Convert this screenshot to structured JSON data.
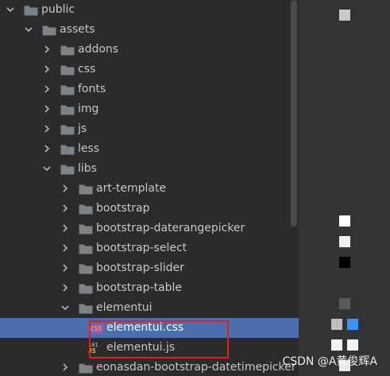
{
  "tree": {
    "items": [
      {
        "label": "public",
        "type": "folder",
        "expanded": true,
        "depth": 0
      },
      {
        "label": "assets",
        "type": "folder",
        "expanded": true,
        "depth": 1
      },
      {
        "label": "addons",
        "type": "folder",
        "expanded": false,
        "depth": 2
      },
      {
        "label": "css",
        "type": "folder",
        "expanded": false,
        "depth": 2
      },
      {
        "label": "fonts",
        "type": "folder",
        "expanded": false,
        "depth": 2
      },
      {
        "label": "img",
        "type": "folder",
        "expanded": false,
        "depth": 2
      },
      {
        "label": "js",
        "type": "folder",
        "expanded": false,
        "depth": 2
      },
      {
        "label": "less",
        "type": "folder",
        "expanded": false,
        "depth": 2
      },
      {
        "label": "libs",
        "type": "folder",
        "expanded": true,
        "depth": 2
      },
      {
        "label": "art-template",
        "type": "folder",
        "expanded": false,
        "depth": 3
      },
      {
        "label": "bootstrap",
        "type": "folder",
        "expanded": false,
        "depth": 3
      },
      {
        "label": "bootstrap-daterangepicker",
        "type": "folder",
        "expanded": false,
        "depth": 3
      },
      {
        "label": "bootstrap-select",
        "type": "folder",
        "expanded": false,
        "depth": 3
      },
      {
        "label": "bootstrap-slider",
        "type": "folder",
        "expanded": false,
        "depth": 3
      },
      {
        "label": "bootstrap-table",
        "type": "folder",
        "expanded": false,
        "depth": 3
      },
      {
        "label": "elementui",
        "type": "folder",
        "expanded": true,
        "depth": 3
      },
      {
        "label": "elementui.css",
        "type": "css-file",
        "selected": true,
        "depth": 4
      },
      {
        "label": "elementui.js",
        "type": "js-file",
        "depth": 4
      },
      {
        "label": "eonasdan-bootstrap-datetimepicker",
        "type": "folder",
        "expanded": false,
        "depth": 3
      }
    ]
  },
  "icons": {
    "folder": "folder-icon",
    "css_file": "css-file-icon",
    "js_file": "js-file-icon",
    "expanded": "chevron-down-icon",
    "collapsed": "chevron-right-icon",
    "css_badge": "CSS",
    "js_badge_top": "101",
    "js_badge_bottom": "JS"
  },
  "colors": {
    "background": "#2b2b2b",
    "selection": "#4b6eaf",
    "text": "#c7c7c7",
    "folder": "#7d8286",
    "highlight_box": "#e0201c",
    "gutter": "#313335"
  },
  "watermark": "CSDN @A黄俊辉A"
}
